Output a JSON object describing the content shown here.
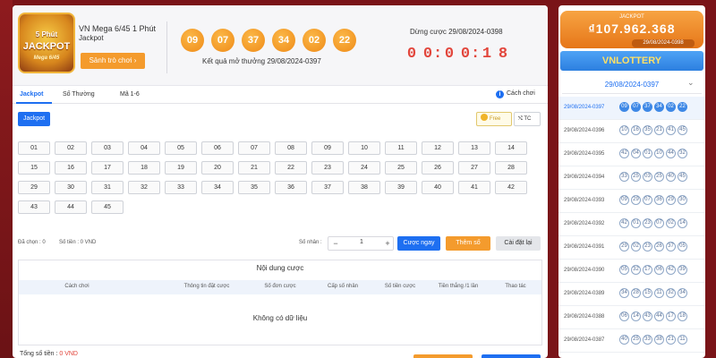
{
  "header": {
    "logo": {
      "line1": "5 Phút",
      "line2": "JACKPOT",
      "line3": "Mega 6/45"
    },
    "game_name": "VN Mega 6/45 1 Phút",
    "game_sub": "Jackpot",
    "help_button": "Sảnh trò chơi",
    "latest_numbers": [
      "09",
      "07",
      "37",
      "34",
      "02",
      "22"
    ],
    "latest_result_label": "Kết quả mở thưởng 29/08/2024-0397",
    "deadline_label": "Dừng cược 29/08/2024-0398",
    "countdown": [
      "0",
      "0",
      "0",
      "0",
      "1",
      "8"
    ]
  },
  "tabs": [
    {
      "label": "Jackpot",
      "active": true
    },
    {
      "label": "Số Thường",
      "active": false
    },
    {
      "label": "Mã 1-6",
      "active": false
    }
  ],
  "howto_label": "Cách chơi",
  "bet_type_chip": "Jackpot",
  "options": {
    "free": "Free",
    "tc": "TC"
  },
  "numbers": [
    "01",
    "02",
    "03",
    "04",
    "05",
    "06",
    "07",
    "08",
    "09",
    "10",
    "11",
    "12",
    "13",
    "14",
    "15",
    "16",
    "17",
    "18",
    "19",
    "20",
    "21",
    "22",
    "23",
    "24",
    "25",
    "26",
    "27",
    "28",
    "29",
    "30",
    "31",
    "32",
    "33",
    "34",
    "35",
    "36",
    "37",
    "38",
    "39",
    "40",
    "41",
    "42",
    "43",
    "44",
    "45"
  ],
  "controls": {
    "selected_label": "Đã chọn : 0",
    "amount_label": "Số tiền : 0 VND",
    "multiplier_label": "Số nhân :",
    "multiplier_value": "1",
    "bet_now": "Cược ngay",
    "add_number": "Thêm số",
    "reset": "Cài đặt lại"
  },
  "bets_table": {
    "title": "Nội dung cược",
    "columns": [
      "Cách chơi",
      "Thông tin đặt cược",
      "Số đơn cược",
      "Cấp số nhân",
      "Số tiền cược",
      "Tiền thắng /1 lần",
      "Thao tác"
    ],
    "empty_text": "Không có dữ liệu"
  },
  "footer": {
    "total_label": "Tổng số tiền :",
    "total_value": "0 VND"
  },
  "sidebar": {
    "jackpot_label": "JACKPOT",
    "jackpot_amount": "₫107.962.368",
    "jackpot_date": "29/08/2024-0398",
    "brand": "VNLOTTERY",
    "selected_draw": "29/08/2024-0397",
    "draws": [
      {
        "id": "29/08/2024-0397",
        "balls": [
          "09",
          "07",
          "37",
          "34",
          "02",
          "22"
        ],
        "active": true
      },
      {
        "id": "29/08/2024-0396",
        "balls": [
          "10",
          "16",
          "35",
          "21",
          "41",
          "45"
        ],
        "active": false
      },
      {
        "id": "29/08/2024-0395",
        "balls": [
          "42",
          "04",
          "01",
          "10",
          "44",
          "32"
        ],
        "active": false
      },
      {
        "id": "29/08/2024-0394",
        "balls": [
          "33",
          "25",
          "03",
          "25",
          "40",
          "45"
        ],
        "active": false
      },
      {
        "id": "29/08/2024-0393",
        "balls": [
          "09",
          "29",
          "07",
          "36",
          "29",
          "30"
        ],
        "active": false
      },
      {
        "id": "29/08/2024-0392",
        "balls": [
          "42",
          "01",
          "23",
          "07",
          "02",
          "14"
        ],
        "active": false
      },
      {
        "id": "29/08/2024-0391",
        "balls": [
          "29",
          "02",
          "23",
          "26",
          "37",
          "05"
        ],
        "active": false
      },
      {
        "id": "29/08/2024-0390",
        "balls": [
          "05",
          "32",
          "17",
          "06",
          "42",
          "39"
        ],
        "active": false
      },
      {
        "id": "29/08/2024-0389",
        "balls": [
          "34",
          "28",
          "15",
          "11",
          "32",
          "34"
        ],
        "active": false
      },
      {
        "id": "29/08/2024-0388",
        "balls": [
          "06",
          "14",
          "43",
          "44",
          "17",
          "18"
        ],
        "active": false
      },
      {
        "id": "29/08/2024-0387",
        "balls": [
          "40",
          "25",
          "33",
          "38",
          "21",
          "11"
        ],
        "active": false
      }
    ]
  }
}
